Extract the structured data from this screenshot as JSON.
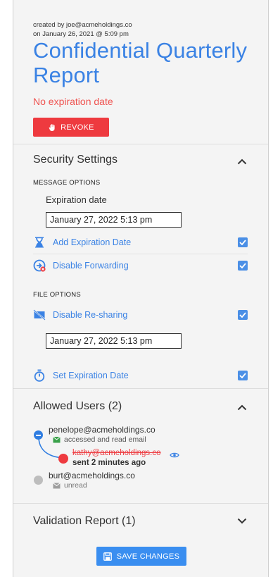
{
  "header": {
    "created_by": "created by joe@acmeholdings.co",
    "created_on": "on January 26, 2021 @ 5:09 pm",
    "title": "Confidential Quarterly Report",
    "expiry_note": "No expiration date",
    "revoke_label": "REVOKE"
  },
  "security": {
    "heading": "Security Settings",
    "message_options_label": "MESSAGE OPTIONS",
    "expiration_date_label": "Expiration date",
    "message_expiration_value": "January 27, 2022 5:13 pm",
    "add_expiration_label": "Add Expiration Date",
    "add_expiration_checked": true,
    "disable_forwarding_label": "Disable Forwarding",
    "disable_forwarding_checked": true,
    "file_options_label": "FILE OPTIONS",
    "disable_resharing_label": "Disable Re-sharing",
    "disable_resharing_checked": true,
    "file_expiration_value": "January 27, 2022 5:13 pm",
    "set_expiration_label": "Set Expiration Date",
    "set_expiration_checked": true
  },
  "users": {
    "heading": "Allowed Users (2)",
    "list": [
      {
        "email": "penelope@acmeholdings.co",
        "status": "accessed and read email",
        "color": "#2f7de1"
      },
      {
        "email": "kathy@acmeholdings.co",
        "status": "sent 2 minutes ago",
        "color": "#ee3a3f"
      },
      {
        "email": "burt@acmeholdings.co",
        "status": "unread",
        "color": "#bdbdbd"
      }
    ]
  },
  "validation": {
    "heading": "Validation Report (1)"
  },
  "footer": {
    "save_label": "SAVE CHANGES"
  },
  "colors": {
    "accent": "#3a82e4",
    "danger": "#ee3a3f",
    "success": "#3aa14a"
  }
}
